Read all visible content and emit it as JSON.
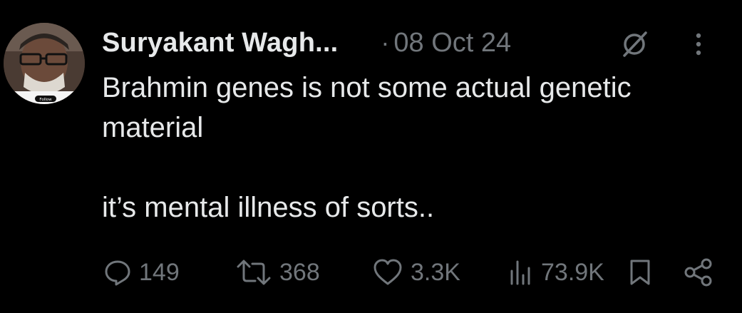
{
  "tweet": {
    "author": {
      "name": "Suryakant Wagh..."
    },
    "separator": "·",
    "date": "08 Oct 24",
    "text": "Brahmin genes is not some actual genetic\nmaterial\n\nit’s mental illness of sorts..",
    "avatar_caption": "Follow"
  },
  "actions": {
    "reply": {
      "icon": "reply-icon",
      "count": "149"
    },
    "retweet": {
      "icon": "retweet-icon",
      "count": "368"
    },
    "like": {
      "icon": "heart-icon",
      "count": "3.3K"
    },
    "views": {
      "icon": "views-icon",
      "count": "73.9K"
    },
    "bookmark": {
      "icon": "bookmark-icon"
    },
    "share": {
      "icon": "share-icon"
    }
  },
  "colors": {
    "background": "#000000",
    "primary_text": "#e7e9ea",
    "secondary_text": "#71767b"
  }
}
